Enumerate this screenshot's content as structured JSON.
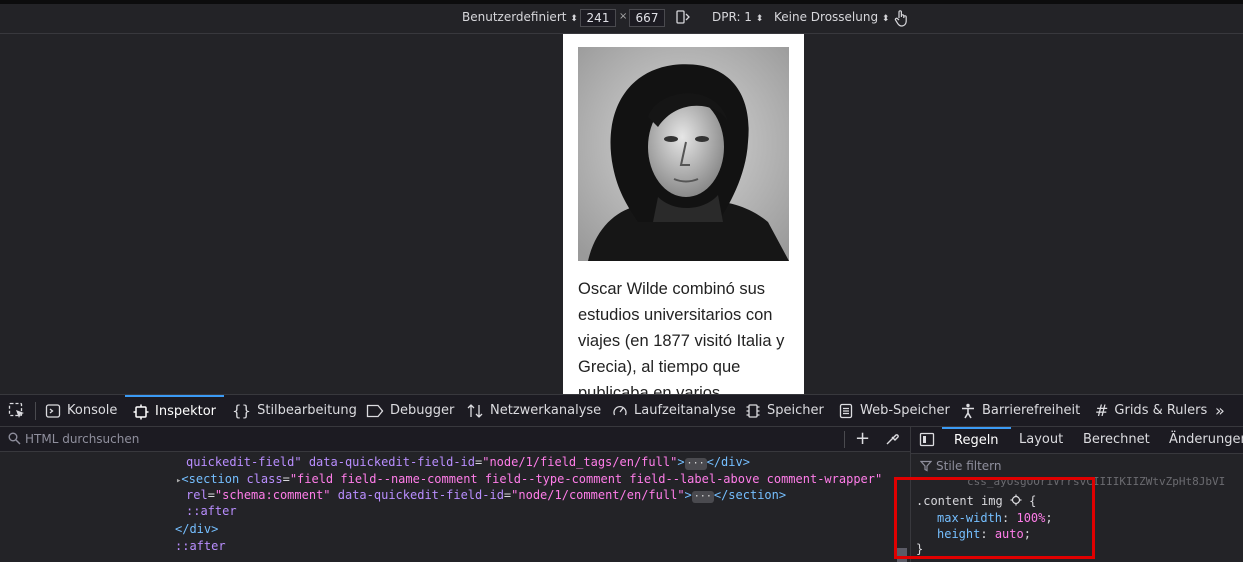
{
  "responsive_toolbar": {
    "device_preset": "Benutzerdefiniert",
    "width": "241",
    "times": "×",
    "height": "667",
    "dpr": "DPR: 1",
    "throttling": "Keine Drosselung"
  },
  "device_content": {
    "paragraph": "Oscar Wilde combinó sus estudios universitarios con viajes (en 1877 visitó Italia y Grecia), al tiempo que publicaba en varios"
  },
  "devtools_tabs": [
    {
      "label": "Konsole"
    },
    {
      "label": "Inspektor"
    },
    {
      "label": "Stilbearbeitung"
    },
    {
      "label": "Debugger"
    },
    {
      "label": "Netzwerkanalyse"
    },
    {
      "label": "Laufzeitanalyse"
    },
    {
      "label": "Speicher"
    },
    {
      "label": "Web-Speicher"
    },
    {
      "label": "Barrierefreiheit"
    },
    {
      "label": "Grids & Rulers"
    }
  ],
  "html_search": {
    "placeholder": "HTML durchsuchen"
  },
  "markup": {
    "line1": {
      "a": "quickedit-field\"",
      "attr": "data-quickedit-field-id",
      "val": "\"node/1/field_tags/en/full\"",
      "close": "</div>"
    },
    "line2": {
      "open": "<section",
      "attr1": "class",
      "val1": "\"field field--name-comment field--type-comment field--label-above comment-wrapper\""
    },
    "line3": {
      "attr1": "rel",
      "val1": "\"schema:comment\"",
      "attr2": "data-quickedit-field-id",
      "val2": "\"node/1/comment/en/full\"",
      "close": "</section>"
    },
    "line4": "::after",
    "line5": "</div>",
    "line6": "::after"
  },
  "sidebar_tabs": [
    {
      "label": "Regeln"
    },
    {
      "label": "Layout"
    },
    {
      "label": "Berechnet"
    },
    {
      "label": "Änderungen"
    }
  ],
  "styles_filter": {
    "placeholder": "Stile filtern"
  },
  "css_rule": {
    "hidden_line": "css_ayOsgOOriVrrsvCIIIIKIIZWtvZpHt8JbVI",
    "selector": ".content img",
    "open_brace": "{",
    "decl1_prop": "max-width",
    "decl1_val": "100%",
    "decl2_prop": "height",
    "decl2_val": "auto",
    "close_brace": "}"
  },
  "colors": {
    "highlight_box": "#e00000",
    "active_tab": "#3b9bf5"
  }
}
